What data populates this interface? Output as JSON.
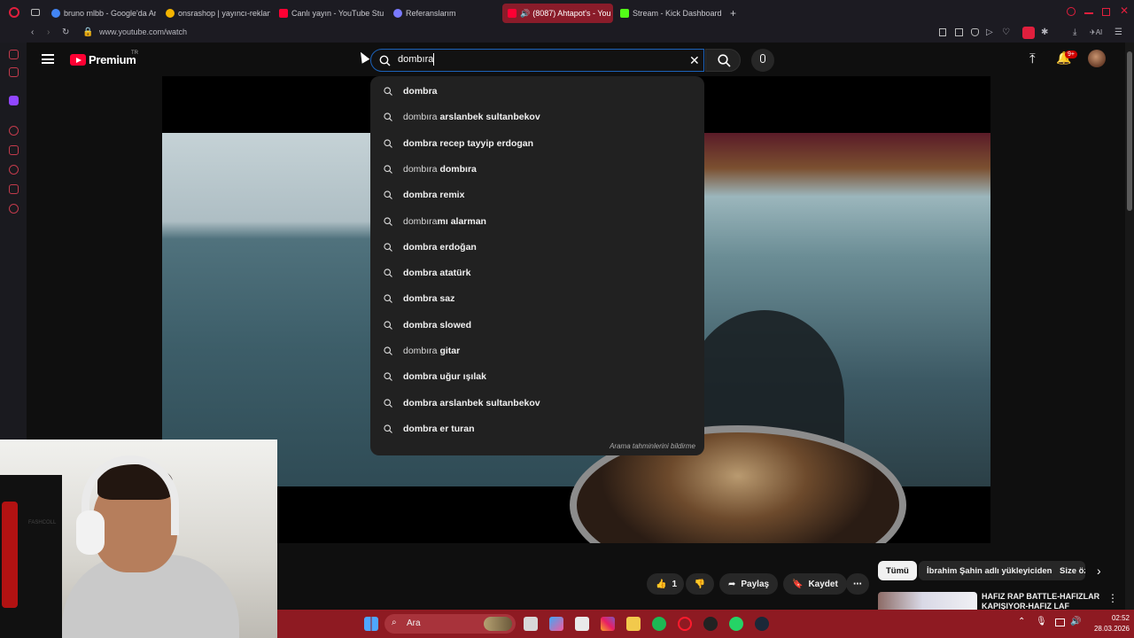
{
  "browser": {
    "tabs": [
      {
        "label": "bruno mlbb - Google'da Ar",
        "icon": "google-icon",
        "color": "#4285f4"
      },
      {
        "label": "onsrashop | yayıncı-reklan",
        "icon": "chrome-store-icon",
        "color": "#f4b400"
      },
      {
        "label": "Canlı yayın - YouTube Stu",
        "icon": "youtube-studio-icon",
        "color": "#ff0033"
      },
      {
        "label": "Referanslarım",
        "icon": "ref-icon",
        "color": "#7a7aff"
      },
      {
        "label": "(8087) Ahtapot's - You",
        "icon": "youtube-icon",
        "color": "#ff0033"
      },
      {
        "label": "Stream - Kick Dashboard",
        "icon": "kick-icon",
        "color": "#53fc18"
      }
    ],
    "new_tab": "+",
    "url": "www.youtube.com/watch"
  },
  "youtube": {
    "logo": "Premium",
    "logo_region": "TR",
    "search_value": "dombıra",
    "notifications_badge": "9+",
    "suggestions": [
      {
        "typed": "",
        "rest": "dombra"
      },
      {
        "typed": "dombıra",
        "rest": " arslanbek sultanbekov"
      },
      {
        "typed": "",
        "rest": "dombra recep tayyip erdogan"
      },
      {
        "typed": "dombıra",
        "rest": " dombıra"
      },
      {
        "typed": "",
        "rest": "dombra remix"
      },
      {
        "typed": "dombıra",
        "rest": "mı alarman"
      },
      {
        "typed": "",
        "rest": "dombra erdoğan"
      },
      {
        "typed": "",
        "rest": "dombra atatürk"
      },
      {
        "typed": "",
        "rest": "dombra saz"
      },
      {
        "typed": "",
        "rest": "dombra slowed"
      },
      {
        "typed": "dombıra",
        "rest": " gitar"
      },
      {
        "typed": "",
        "rest": "dombra uğur ışılak"
      },
      {
        "typed": "",
        "rest": "dombra arslanbek sultanbekov"
      },
      {
        "typed": "",
        "rest": "dombra er turan"
      }
    ],
    "report_link": "Arama tahminlerini bildirme",
    "actions": {
      "like_count": "1",
      "share": "Paylaş",
      "save": "Kaydet",
      "more": "⋯"
    },
    "chips": [
      "Tümü",
      "İbrahim Şahin adlı yükleyiciden",
      "Size öz"
    ],
    "rec_title": "HAFIZ RAP BATTLE-HAFIZLAR KAPIŞIYOR-HAFIZ LAF"
  },
  "webcam": {
    "shirt_text": "FASHCOLL"
  },
  "taskbar": {
    "search_placeholder": "Ara",
    "time": "02:52",
    "date": "28.03.2026"
  },
  "colors": {
    "accent": "#ff0033",
    "taskbar": "#8e1a22",
    "search_border": "#1c62b9"
  }
}
